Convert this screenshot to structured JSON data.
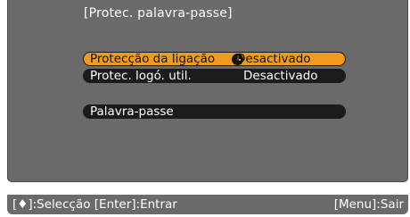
{
  "menu": {
    "title": "[Protec. palavra-passe]",
    "items": [
      {
        "label": "Protecção da ligação",
        "value": "Desactivado",
        "selected": true,
        "icon": "clock-icon"
      },
      {
        "label": "Protec. logó. util.",
        "value": "Desactivado",
        "selected": false
      },
      {
        "label": "Palavra-passe",
        "value": "",
        "selected": false
      }
    ]
  },
  "footer": {
    "left_hint": "[♦]:Selecção [Enter]:Entrar",
    "right_hint": "[Menu]:Sair"
  },
  "colors": {
    "panel_background": "#6a6a6a",
    "item_background": "#1b1b1b",
    "selection_highlight": "#f29a1f",
    "text": "#ffffff"
  }
}
